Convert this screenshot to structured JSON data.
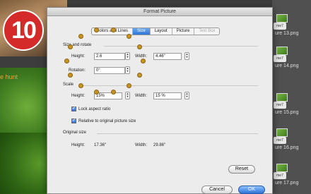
{
  "background": {
    "caption": "e hunt",
    "files": [
      {
        "badge": "me7",
        "name": "ure 13.png"
      },
      {
        "badge": "me7",
        "name": "ure 14.png"
      },
      {
        "badge": "me7",
        "name": "ure 15.png"
      },
      {
        "badge": "me7",
        "name": "ure 16.png"
      },
      {
        "badge": "me7",
        "name": "ure 17.png"
      }
    ],
    "step_number": "10"
  },
  "dialog": {
    "title": "Format Picture",
    "tabs": [
      "Colors and Lines",
      "Size",
      "Layout",
      "Picture",
      "Text Box"
    ],
    "active_tab": "Size",
    "size_rotate": {
      "section_label": "Size and rotate",
      "height_label": "Height:",
      "height_value": "2.6",
      "width_label": "Width:",
      "width_value": "4.46\"",
      "rotation_label": "Rotation:",
      "rotation_value": "0°"
    },
    "scale": {
      "section_label": "Scale",
      "height_label": "Height:",
      "height_value": "15%",
      "width_label": "Width:",
      "width_value": "15 %"
    },
    "lock_aspect": {
      "label": "Lock aspect ratio",
      "checked": true
    },
    "relative_original": {
      "label": "Relative to original picture size",
      "checked": true
    },
    "original_size": {
      "section_label": "Original size",
      "height_label": "Height:",
      "height_value": "17.36\"",
      "width_label": "Width:",
      "width_value": "29.86\""
    },
    "reset_label": "Reset",
    "cancel_label": "Cancel",
    "ok_label": "OK"
  },
  "colors": {
    "accent_blue": "#2f74d8",
    "step_badge_red": "#d42a2a",
    "annotation_dots": "#c8941e"
  }
}
